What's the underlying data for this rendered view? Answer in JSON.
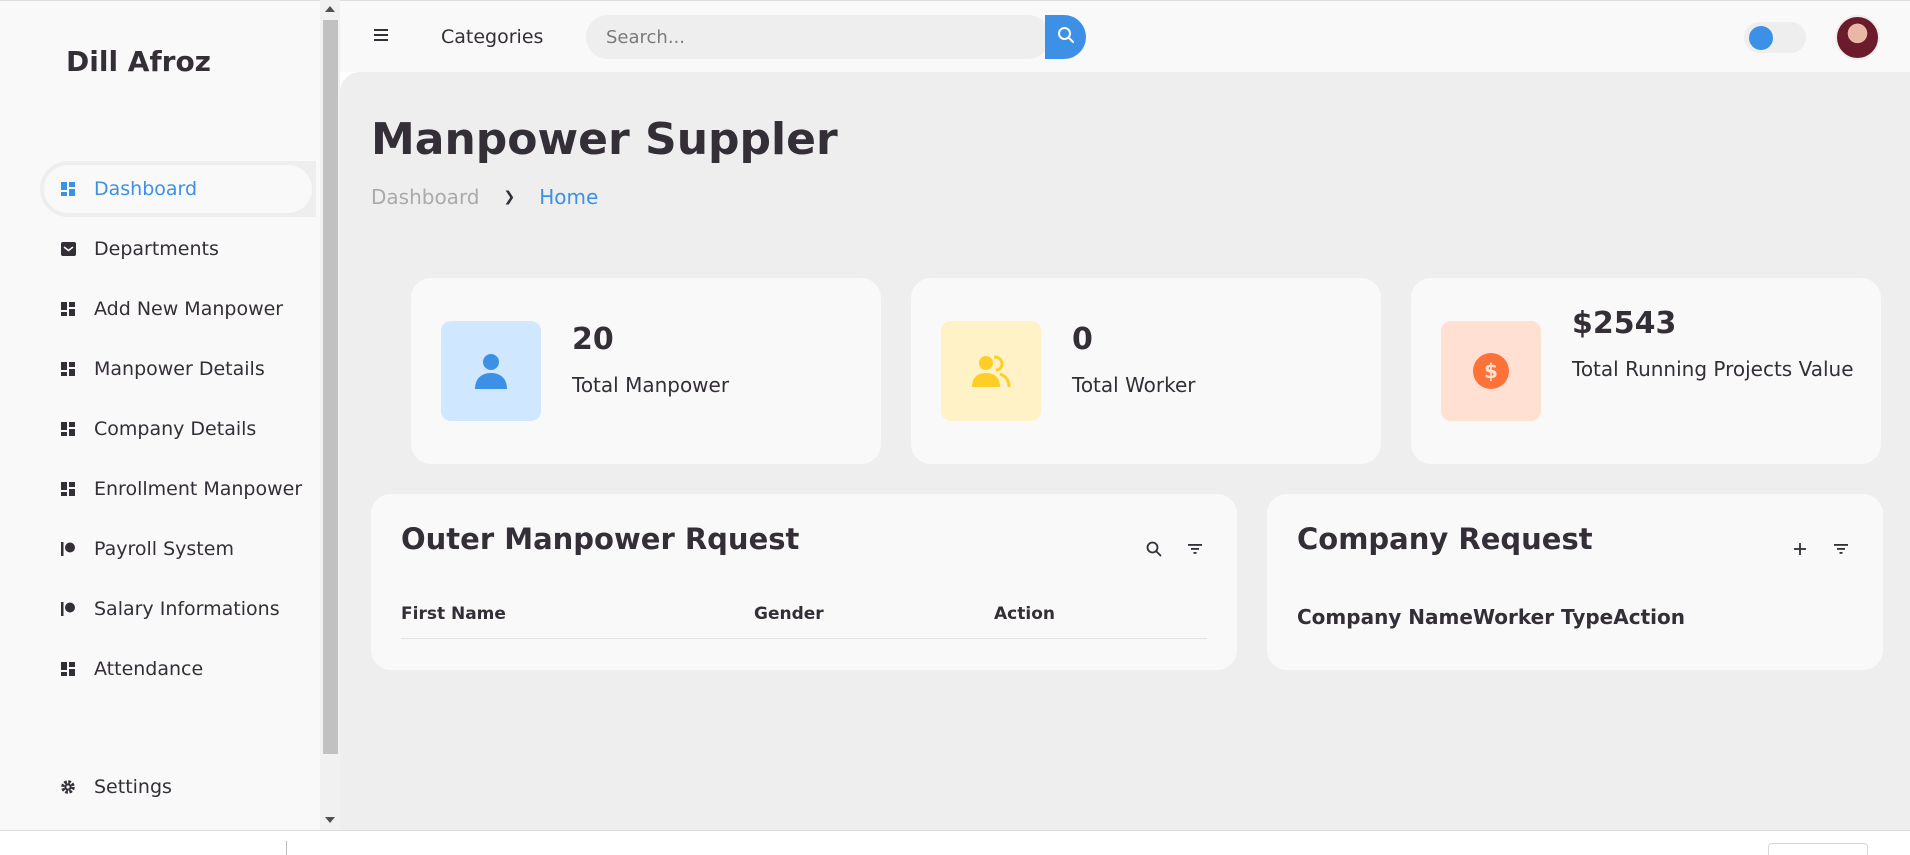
{
  "sidebar": {
    "brand": "Dill Afroz",
    "items": [
      {
        "label": "Dashboard",
        "icon": "dashboard-grid-icon"
      },
      {
        "label": "Departments",
        "icon": "inbox-icon"
      },
      {
        "label": "Add New Manpower",
        "icon": "dashboard-grid-icon"
      },
      {
        "label": "Manpower Details",
        "icon": "dashboard-grid-icon"
      },
      {
        "label": "Company Details",
        "icon": "dashboard-grid-icon"
      },
      {
        "label": "Enrollment Manpower",
        "icon": "dashboard-grid-icon"
      },
      {
        "label": "Payroll System",
        "icon": "patreon-icon"
      },
      {
        "label": "Salary Informations",
        "icon": "patreon-icon"
      },
      {
        "label": "Attendance",
        "icon": "dashboard-grid-icon"
      }
    ],
    "settings_label": "Settings"
  },
  "topbar": {
    "categories": "Categories",
    "search_placeholder": "Search..."
  },
  "header": {
    "title": "Manpower Suppler",
    "breadcrumb": {
      "parent": "Dashboard",
      "current": "Home"
    }
  },
  "stats": [
    {
      "value": "20",
      "label": "Total Manpower",
      "icon": "user-icon",
      "bg": "#cfe8ff",
      "color": "#3c91e6"
    },
    {
      "value": "0",
      "label": "Total Worker",
      "icon": "group-icon",
      "bg": "#fff2c6",
      "color": "#ffce26"
    },
    {
      "value": "$2543",
      "label": "Total Running Projects Value",
      "icon": "dollar-circle-icon",
      "bg": "#ffe0d3",
      "color": "#fd7238"
    }
  ],
  "outer_request": {
    "title": "Outer Manpower Rquest",
    "columns": [
      "First Name",
      "Gender",
      "Action"
    ]
  },
  "company_request": {
    "title": "Company Request",
    "columns": [
      "Company Name",
      "Worker Type",
      "Action"
    ]
  },
  "colors": {
    "accent": "#3c91e6",
    "text": "#342e37",
    "bg": "#eeeeee",
    "surface": "#f9f9f9"
  }
}
